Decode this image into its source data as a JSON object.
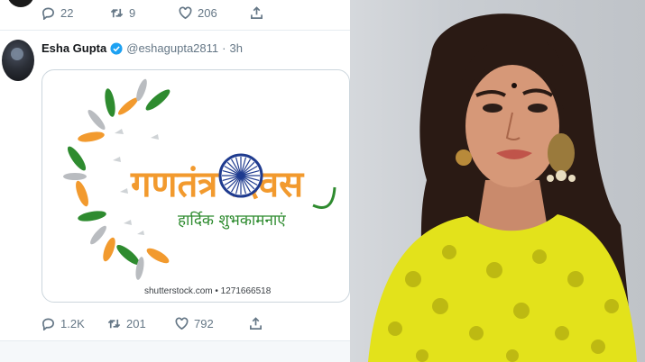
{
  "prev_tweet": {
    "actions": {
      "replies": "22",
      "retweets": "9",
      "likes": "206"
    }
  },
  "tweet": {
    "author": {
      "name": "Esha Gupta",
      "handle": "@eshagupta2811",
      "time": "3h"
    },
    "image": {
      "title_hindi": "गणतंत्र दिवस",
      "subtitle_hindi": "हार्दिक शुभकामनाएं",
      "watermark": "shutterstock.com • 1271666518"
    },
    "actions": {
      "replies": "1.2K",
      "retweets": "201",
      "likes": "792"
    }
  },
  "icons": [
    "reply-icon",
    "retweet-icon",
    "like-icon",
    "share-icon",
    "verified-badge-icon",
    "ashoka-chakra-icon"
  ],
  "colors": {
    "saffron": "#f29a2e",
    "green": "#2e8b2f",
    "navy": "#1f3b8f",
    "twitter_gray": "#657786",
    "verified_blue": "#1da1f2",
    "dress_yellow": "#e3e21b"
  }
}
